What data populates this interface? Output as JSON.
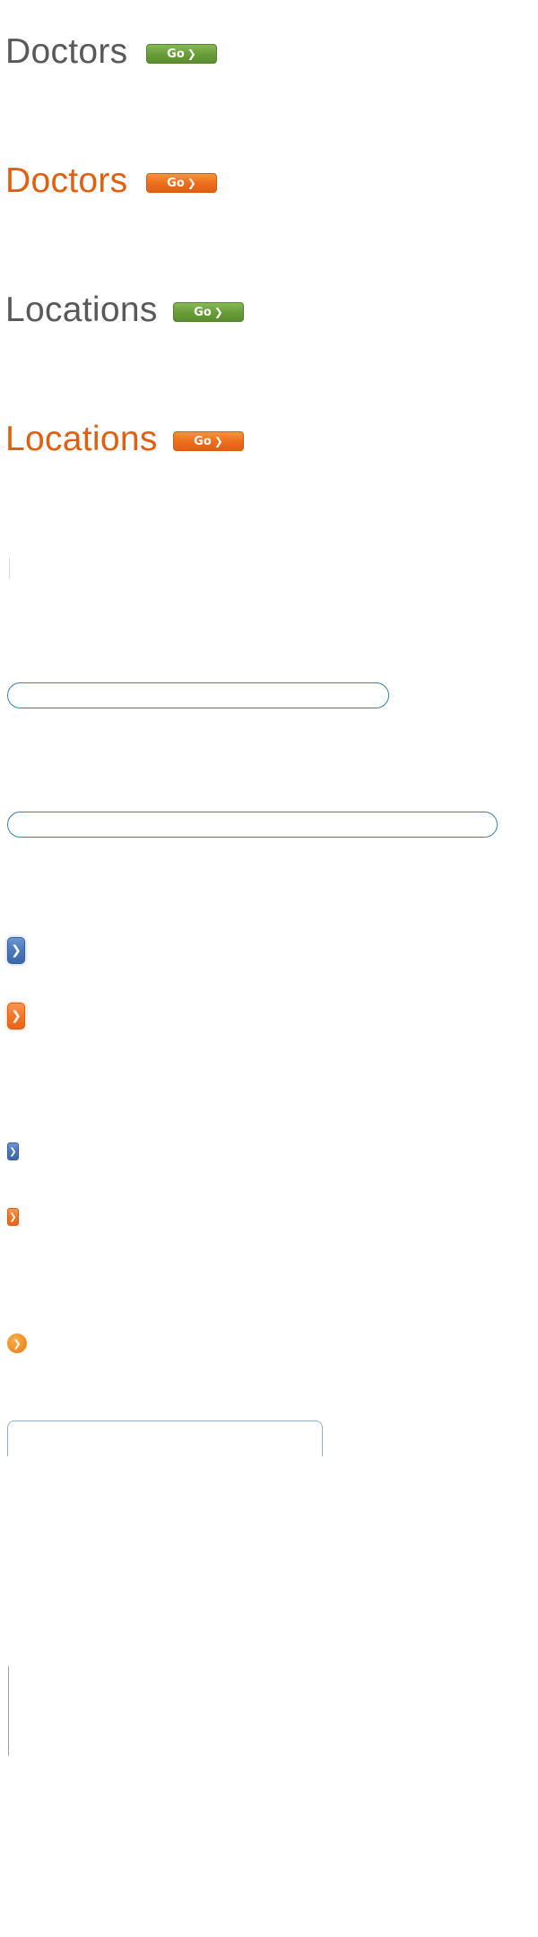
{
  "headings": [
    {
      "text": "Doctors",
      "color": "gray"
    },
    {
      "text": "Doctors",
      "color": "orange"
    },
    {
      "text": "Locations",
      "color": "gray"
    },
    {
      "text": "Locations",
      "color": "orange"
    }
  ],
  "go_buttons": [
    {
      "label": "Go",
      "arrow": "❯",
      "color": "green"
    },
    {
      "label": "Go",
      "arrow": "❯",
      "color": "orange"
    },
    {
      "label": "Go",
      "arrow": "❯",
      "color": "green"
    },
    {
      "label": "Go",
      "arrow": "❯",
      "color": "orange"
    }
  ],
  "inputs": {
    "short_field": {
      "value": "",
      "placeholder": ""
    },
    "long_field": {
      "value": "",
      "placeholder": ""
    }
  },
  "arrow_buttons": {
    "glyph": "❯",
    "large_blue": "❯",
    "large_orange": "❯",
    "small_blue": "❯",
    "small_orange": "❯",
    "round_orange": "❯"
  },
  "colors": {
    "gray_text": "#59595b",
    "orange_text": "#e05f10",
    "green_button": "#6a9e3a",
    "orange_button": "#ee6f1d",
    "blue_button": "#4a78b8",
    "input_border": "#3a83a8"
  }
}
